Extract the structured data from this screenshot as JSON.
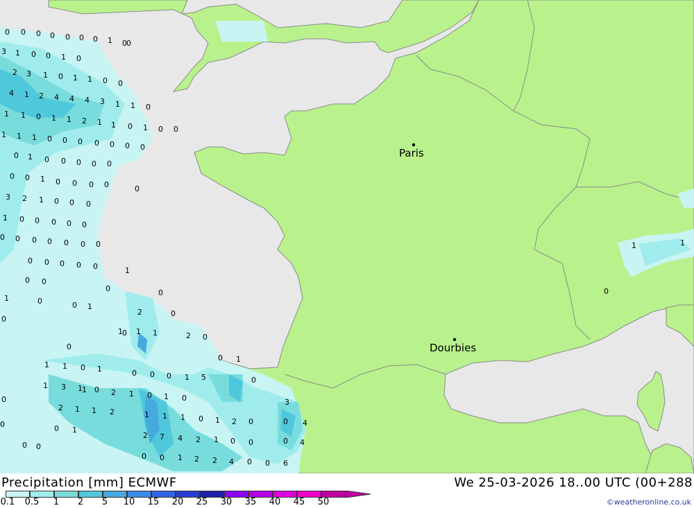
{
  "map": {
    "title": "Precipitation [mm] ECMWF",
    "valid_time": "We 25-03-2026 18..00 UTC (00+288",
    "credit": "©weatheronline.co.uk",
    "colors": {
      "sea": "#e8e8e8",
      "land": "#b9f28c",
      "border": "#8a8a8a"
    },
    "cities": [
      {
        "name": "Paris"
      },
      {
        "name": "Dourbies"
      }
    ],
    "legend": {
      "colors": [
        "#c8f4f4",
        "#a0ecec",
        "#78dcdc",
        "#50c8dc",
        "#46aade",
        "#3c8ce6",
        "#3264e6",
        "#283cd2",
        "#1e1eaa",
        "#8c00ff",
        "#b400e6",
        "#dc00dc",
        "#f000c8",
        "#c000a0"
      ],
      "labels": [
        "0.1",
        "0.5",
        "1",
        "2",
        "5",
        "10",
        "15",
        "20",
        "25",
        "30",
        "35",
        "40",
        "45",
        "50"
      ]
    },
    "grid_values": [
      "0",
      "0",
      "0",
      "0",
      "0",
      "0",
      "0",
      "1",
      "0",
      "0",
      "3",
      "1",
      "0",
      "0",
      "1",
      "0",
      "2",
      "3",
      "1",
      "0",
      "1",
      "1",
      "0",
      "0",
      "4",
      "1",
      "2",
      "4",
      "4",
      "4",
      "3",
      "1",
      "1",
      "0",
      "1",
      "1",
      "0",
      "1",
      "1",
      "2",
      "1",
      "1",
      "0",
      "1",
      "0",
      "0",
      "1",
      "1",
      "1",
      "0",
      "0",
      "0",
      "0",
      "0",
      "0",
      "0",
      "0",
      "1",
      "0",
      "0",
      "0",
      "0",
      "0",
      "0",
      "0",
      "1",
      "0",
      "0",
      "0",
      "0",
      "0",
      "3",
      "2",
      "1",
      "0",
      "0",
      "0",
      "1",
      "0",
      "0",
      "0",
      "0",
      "0",
      "0",
      "0",
      "0",
      "0",
      "0",
      "0",
      "0",
      "0",
      "0",
      "0",
      "0",
      "0",
      "1",
      "0",
      "0",
      "0",
      "1",
      "0",
      "0",
      "1",
      "0",
      "0",
      "2",
      "0",
      "0",
      "1",
      "1",
      "1",
      "2",
      "0",
      "1",
      "1",
      "0",
      "1",
      "0",
      "0",
      "1",
      "0",
      "0",
      "0",
      "1",
      "5",
      "0",
      "1",
      "1",
      "3",
      "1",
      "0",
      "2",
      "1",
      "0",
      "1",
      "0",
      "2",
      "1",
      "1",
      "2",
      "1",
      "1",
      "1",
      "0",
      "1",
      "2",
      "0",
      "0",
      "1",
      "0",
      "4",
      "3",
      "0",
      "2",
      "7",
      "4",
      "2",
      "1",
      "0",
      "0",
      "0",
      "4",
      "0",
      "0",
      "1",
      "2",
      "2",
      "4",
      "0",
      "0",
      "6",
      "0",
      "0",
      "0",
      "1",
      "1",
      "0"
    ]
  }
}
